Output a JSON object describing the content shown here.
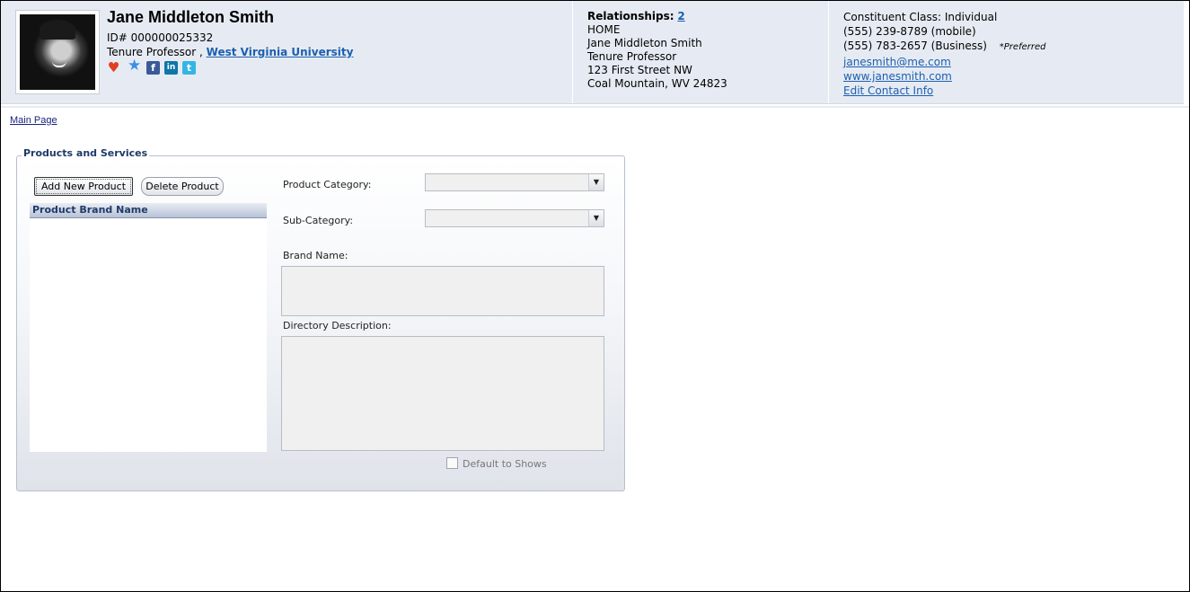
{
  "profile": {
    "name": "Jane Middleton Smith",
    "id_line": "ID# 000000025332",
    "title": "Tenure Professor ,",
    "organization": "West Virginia University"
  },
  "relationships": {
    "label": "Relationships:",
    "count": "2",
    "address_type": "HOME",
    "address_name": "Jane Middleton Smith",
    "address_title": "Tenure Professor",
    "street": "123 First Street NW",
    "city_state_zip": "Coal Mountain, WV 24823"
  },
  "contact": {
    "constituent_class": "Constituent Class: Individual",
    "phone_mobile": "(555) 239-8789 (mobile)",
    "phone_business": "(555) 783-2657 (Business)",
    "preferred": "*Preferred",
    "email": "janesmith@me.com",
    "website": "www.janesmith.com",
    "edit_link": "Edit Contact Info"
  },
  "nav": {
    "main_page": "Main Page"
  },
  "products": {
    "legend": "Products and Services",
    "add_button": "Add New Product",
    "delete_button": "Delete Product",
    "list_header": "Product Brand Name",
    "product_category_label": "Product Category:",
    "product_category_value": "",
    "sub_category_label": "Sub-Category:",
    "sub_category_value": "",
    "brand_name_label": "Brand Name:",
    "brand_name_value": "",
    "description_label": "Directory Description:",
    "description_value": "",
    "default_shows_label": "Default to Shows",
    "default_shows_checked": false
  },
  "icons": {
    "heart": "heart-icon",
    "star": "star-icon",
    "facebook": "facebook-icon",
    "linkedin": "linkedin-icon",
    "twitter": "twitter-icon",
    "dropdown": "chevron-down-icon"
  }
}
